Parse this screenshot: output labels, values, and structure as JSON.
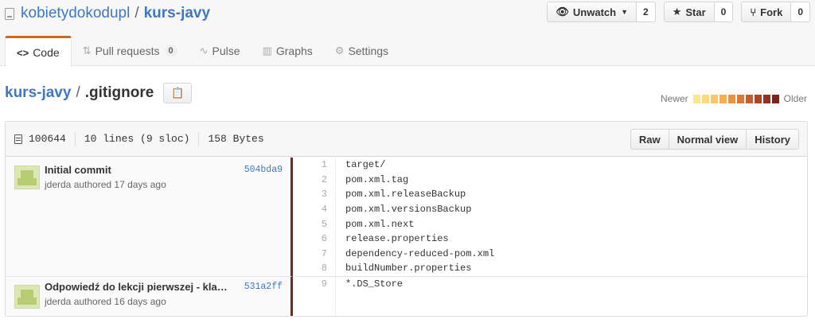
{
  "repo": {
    "owner": "kobietydokodupl",
    "separator": "/",
    "name": "kurs-javy"
  },
  "actions": {
    "watch": {
      "label": "Unwatch",
      "count": "2"
    },
    "star": {
      "label": "Star",
      "count": "0"
    },
    "fork": {
      "label": "Fork",
      "count": "0"
    }
  },
  "tabs": [
    {
      "label": "Code",
      "icon": "code-icon"
    },
    {
      "label": "Pull requests",
      "badge": "0",
      "icon": "pull-request-icon"
    },
    {
      "label": "Pulse",
      "icon": "pulse-icon"
    },
    {
      "label": "Graphs",
      "icon": "graph-icon"
    },
    {
      "label": "Settings",
      "icon": "gear-icon"
    }
  ],
  "breadcrumb": {
    "repo": "kurs-javy",
    "separator": "/",
    "file": ".gitignore"
  },
  "heat": {
    "newer": "Newer",
    "older": "Older",
    "colors": [
      "#ffe68a",
      "#fcd97c",
      "#f9c66a",
      "#f6ae53",
      "#f1923c",
      "#e07634",
      "#c85b2e",
      "#ad4427",
      "#913223",
      "#7a2620"
    ]
  },
  "file": {
    "mode": "100644",
    "lines": "10 lines (9 sloc)",
    "size": "158 Bytes",
    "buttons": {
      "raw": "Raw",
      "normal": "Normal view",
      "history": "History"
    }
  },
  "commits": [
    {
      "message": "Initial commit",
      "author": "jderda authored 17 days ago",
      "sha": "504bda9"
    },
    {
      "message": "Odpowiedź do lekcji pierwszej - kla…",
      "author": "jderda authored 16 days ago",
      "sha": "531a2ff"
    }
  ],
  "code_lines": [
    {
      "n": "1",
      "text": "target/"
    },
    {
      "n": "2",
      "text": "pom.xml.tag"
    },
    {
      "n": "3",
      "text": "pom.xml.releaseBackup"
    },
    {
      "n": "4",
      "text": "pom.xml.versionsBackup"
    },
    {
      "n": "5",
      "text": "pom.xml.next"
    },
    {
      "n": "6",
      "text": "release.properties"
    },
    {
      "n": "7",
      "text": "dependency-reduced-pom.xml"
    },
    {
      "n": "8",
      "text": "buildNumber.properties"
    },
    {
      "n": "9",
      "text": "*.DS_Store"
    }
  ]
}
